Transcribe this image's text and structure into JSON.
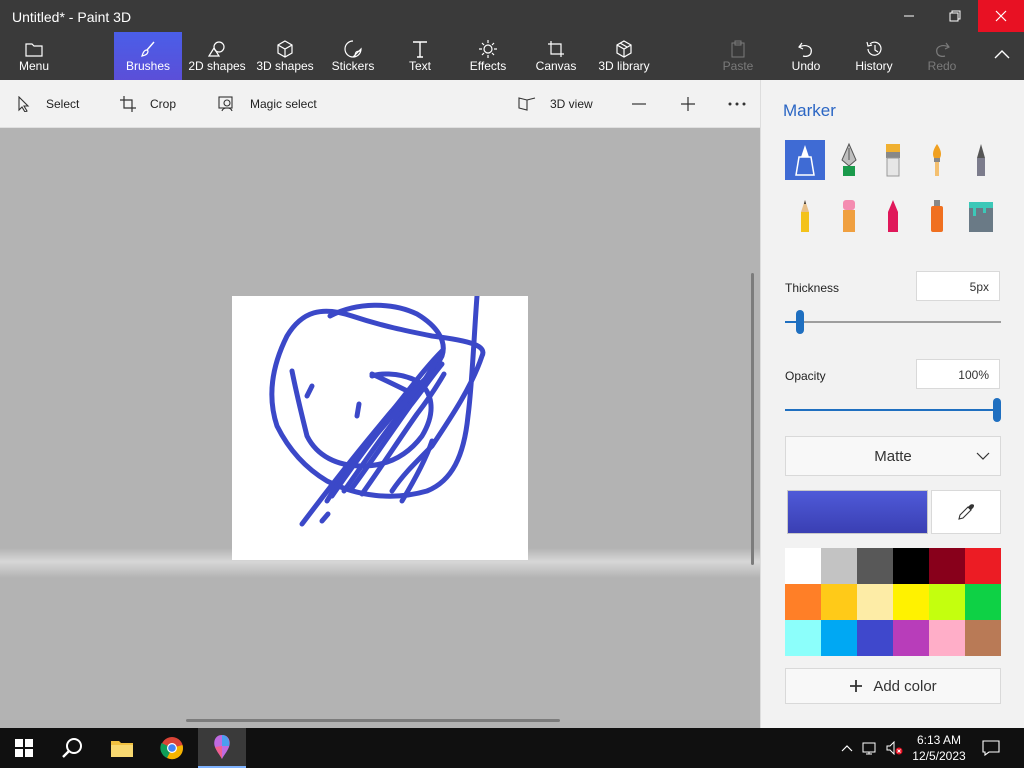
{
  "window": {
    "title": "Untitled* - Paint 3D",
    "minimize_label": "—",
    "restore_label": "❐",
    "close_label": "✕"
  },
  "ribbon": {
    "menu": "Menu",
    "brushes": "Brushes",
    "shapes2d": "2D shapes",
    "shapes3d": "3D shapes",
    "stickers": "Stickers",
    "text": "Text",
    "effects": "Effects",
    "canvas": "Canvas",
    "library3d": "3D library",
    "paste": "Paste",
    "undo": "Undo",
    "history": "History",
    "redo": "Redo"
  },
  "subbar": {
    "select": "Select",
    "crop": "Crop",
    "magic_select": "Magic select",
    "view3d": "3D view"
  },
  "panel": {
    "title": "Marker",
    "thickness_label": "Thickness",
    "thickness_value": "5px",
    "thickness_level": 0.05,
    "opacity_label": "Opacity",
    "opacity_value": "100%",
    "opacity_level": 1.0,
    "finish": "Matte",
    "add_color": "Add color",
    "current_color": "#4f5ad8",
    "tools": [
      "marker",
      "calligraphy-pen",
      "oil-brush",
      "watercolor",
      "pixel-pen",
      "pencil",
      "eraser",
      "crayon",
      "spray-can",
      "fill-bucket"
    ],
    "palette": [
      "#ffffff",
      "#c3c3c3",
      "#585858",
      "#000000",
      "#88001b",
      "#ec1c24",
      "#ff7f27",
      "#ffca18",
      "#fdeca6",
      "#fff200",
      "#c4ff0e",
      "#0ed145",
      "#8cfffb",
      "#00a8f3",
      "#3f48cc",
      "#b83dba",
      "#ffaec8",
      "#b97a56"
    ]
  },
  "taskbar": {
    "time": "6:13 AM",
    "date": "12/5/2023"
  },
  "colors": {
    "stroke": "#3b48c8",
    "accent": "#2b66c4"
  }
}
